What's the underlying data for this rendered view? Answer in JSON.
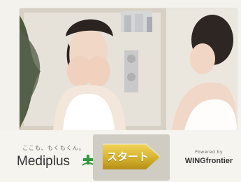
{
  "banner": {
    "tagline": "ここも、もくもくん。",
    "brand_name": "Mediplus",
    "brand_icon": "leaf-plus-icon",
    "start_label": "スタート",
    "powered_by": "Powered by",
    "partner": "WINGfrontier"
  },
  "colors": {
    "start_gold": "#d6b22d",
    "start_gold_dark": "#b48f18",
    "brand_green": "#2e9a3a"
  }
}
